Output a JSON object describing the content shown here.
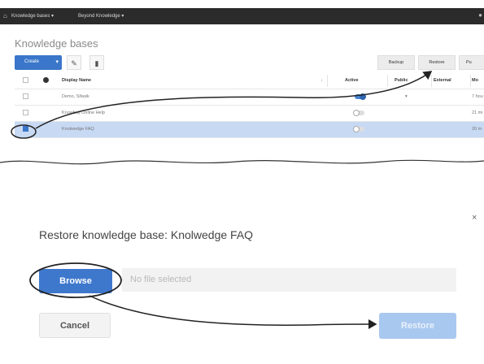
{
  "topbar": {
    "menu_knowledge_bases": "Knowledge bases ▾",
    "menu_beyond_knowledge": "Beyond Knowledge ▾"
  },
  "kb_page": {
    "title": "Knowledge bases",
    "toolbar": {
      "create_label": "Create",
      "backup_label": "Backup",
      "restore_label": "Restore",
      "partial_label": "Pu"
    },
    "table": {
      "headers": {
        "display_name": "Display Name",
        "active": "Active",
        "public": "Public",
        "external": "External",
        "partial": "Mo"
      },
      "rows": [
        {
          "name": "Demo, Sifasik",
          "active": true,
          "public_mark": "▾",
          "modified": "7 hou"
        },
        {
          "name": "Knowbuy Online Help",
          "active": false,
          "public_mark": "",
          "modified": "21 mi"
        },
        {
          "name": "Knolwedge FAQ",
          "active": false,
          "public_mark": "",
          "modified": "20 m",
          "selected": true
        }
      ]
    }
  },
  "dialog": {
    "title": "Restore knowledge base: Knolwedge FAQ",
    "browse_label": "Browse",
    "file_placeholder": "No file selected",
    "cancel_label": "Cancel",
    "restore_label": "Restore",
    "close_glyph": "×"
  },
  "colors": {
    "accent": "#3e78cd",
    "disabled_accent": "#a9c8ef",
    "selected_row": "#c7d9f3",
    "topbar": "#2b2b2b"
  }
}
